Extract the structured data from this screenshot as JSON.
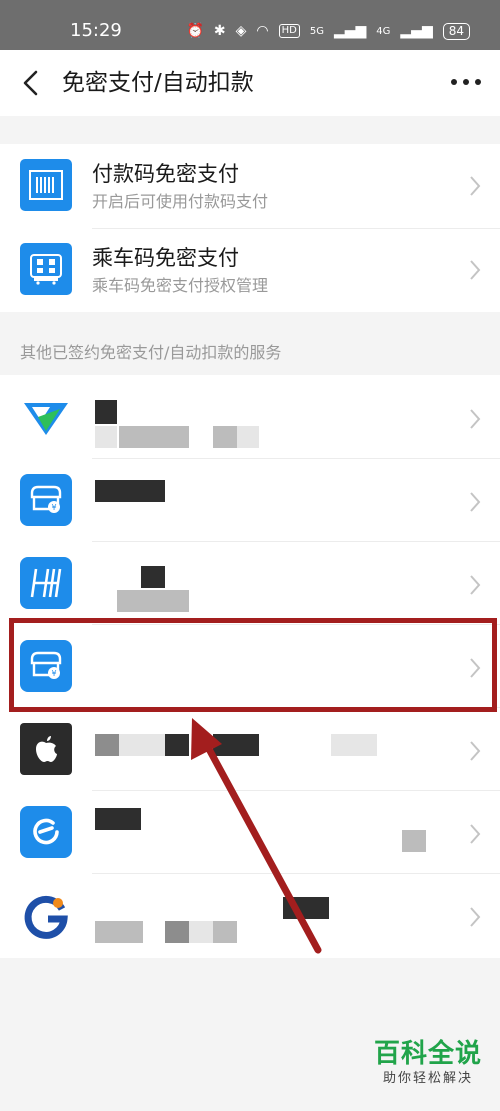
{
  "status_bar": {
    "time": "15:29",
    "battery": "84",
    "network_badge": "HD",
    "signal_5g": "5G",
    "signal_4g": "4G"
  },
  "nav": {
    "title": "免密支付/自动扣款",
    "back_icon": "back-arrow-icon",
    "more_icon": "more-dots-icon"
  },
  "primary_services": [
    {
      "title": "付款码免密支付",
      "subtitle": "开启后可使用付款码支付",
      "icon": "barcode-icon"
    },
    {
      "title": "乘车码免密支付",
      "subtitle": "乘车码免密支付授权管理",
      "icon": "bus-qr-icon"
    }
  ],
  "section_header": "其他已签约免密支付/自动扣款的服务",
  "signed_services": [
    {
      "icon": "green-v-logo-icon",
      "icon_color": "#1e8cea"
    },
    {
      "icon": "store-payment-icon",
      "icon_color": "#1e8cea"
    },
    {
      "icon": "h-logo-icon",
      "icon_color": "#1e8cea"
    },
    {
      "icon": "store-payment-icon",
      "icon_color": "#1e8cea",
      "highlighted": true
    },
    {
      "icon": "apple-logo-icon",
      "icon_color": "#2b2b2b"
    },
    {
      "icon": "e-logo-icon",
      "icon_color": "#1e8cea"
    },
    {
      "icon": "g-logo-icon",
      "icon_color": "#1e4fa8"
    }
  ],
  "annotation": {
    "highlight_color": "#a31e1e"
  },
  "watermark": {
    "brand": "百科全说",
    "tagline": "助你轻松解决"
  }
}
